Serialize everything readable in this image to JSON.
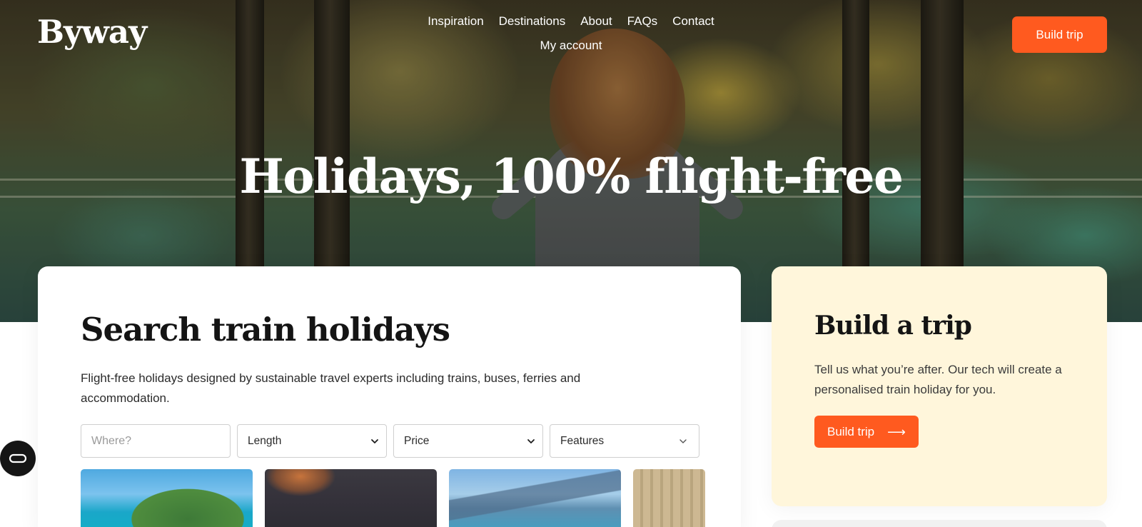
{
  "brand": {
    "logo_text": "Byway"
  },
  "nav": {
    "items": [
      "Inspiration",
      "Destinations",
      "About",
      "FAQs",
      "Contact",
      "My account"
    ]
  },
  "header": {
    "cta_label": "Build trip"
  },
  "hero": {
    "title": "Holidays, 100% flight-free"
  },
  "search": {
    "title": "Search train holidays",
    "description": "Flight-free holidays designed by sustainable travel experts including trains, buses, ferries and accommodation.",
    "where_placeholder": "Where?",
    "length_label": "Length",
    "price_label": "Price",
    "features_label": "Features"
  },
  "build": {
    "title": "Build a trip",
    "description": "Tell us what you’re after. Our tech will create a personalised train holiday for you.",
    "cta_label": "Build trip",
    "cta_arrow": "⟶"
  },
  "colors": {
    "accent": "#ff5a1f",
    "build_card_bg": "#fff6db"
  },
  "icons": {
    "accessibility": "accessibility-icon",
    "chevron": "chevron-down-icon",
    "arrow": "arrow-right-icon"
  }
}
